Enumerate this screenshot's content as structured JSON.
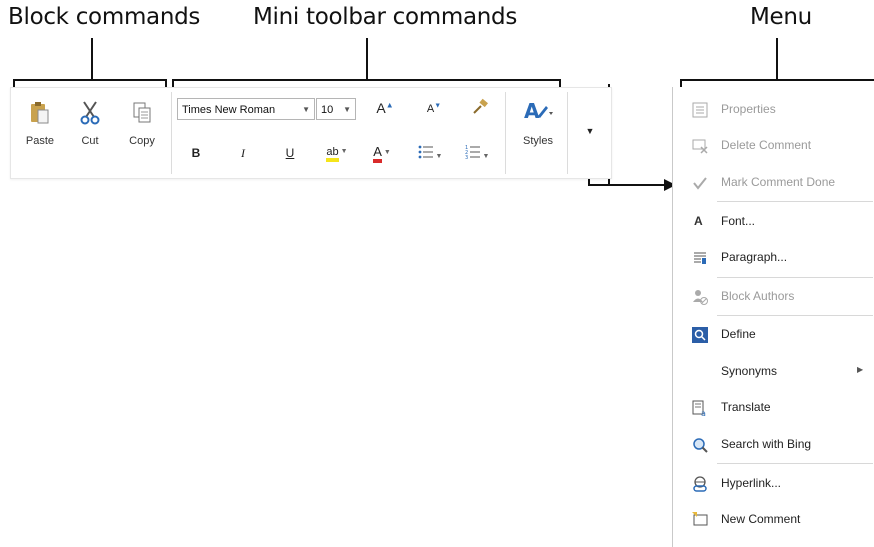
{
  "callouts": {
    "block": "Block commands",
    "mini": "Mini toolbar commands",
    "menu": "Menu"
  },
  "block_commands": [
    {
      "label": "Paste",
      "icon": "clipboard-paste-icon"
    },
    {
      "label": "Cut",
      "icon": "scissors-icon"
    },
    {
      "label": "Copy",
      "icon": "copy-icon"
    }
  ],
  "mini_toolbar": {
    "font_name": "Times New Roman",
    "font_size": "10",
    "bold": "B",
    "italic": "I",
    "underline": "U",
    "styles_label": "Styles",
    "highlight_color": "#f5e51b",
    "font_color": "#d92b2b"
  },
  "menu": {
    "items": [
      {
        "label": "Properties",
        "icon": "properties-icon",
        "enabled": false
      },
      {
        "label": "Delete Comment",
        "icon": "delete-comment-icon",
        "enabled": false
      },
      {
        "label": "Mark Comment Done",
        "icon": "checkmark-icon",
        "enabled": false
      },
      {
        "label": "Font...",
        "icon": "font-icon",
        "enabled": true
      },
      {
        "label": "Paragraph...",
        "icon": "paragraph-icon",
        "enabled": true
      },
      {
        "label": "Block Authors",
        "icon": "block-authors-icon",
        "enabled": false
      },
      {
        "label": "Define",
        "icon": "define-icon",
        "enabled": true
      },
      {
        "label": "Synonyms",
        "icon": "",
        "enabled": true
      },
      {
        "label": "Translate",
        "icon": "translate-icon",
        "enabled": true
      },
      {
        "label": "Search with Bing",
        "icon": "search-icon",
        "enabled": true
      },
      {
        "label": "Hyperlink...",
        "icon": "hyperlink-icon",
        "enabled": true
      },
      {
        "label": "New Comment",
        "icon": "new-comment-icon",
        "enabled": true
      }
    ]
  }
}
